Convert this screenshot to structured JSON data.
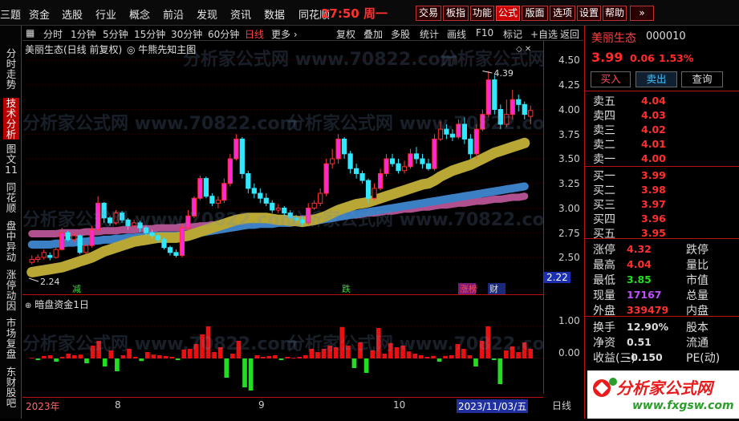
{
  "menu": {
    "items": [
      "三题",
      "资金",
      "选股",
      "行业",
      "概念",
      "前沿",
      "发现",
      "资讯",
      "数据",
      "同花顺"
    ],
    "clock": "27:50",
    "weekday": "周一",
    "buttons": [
      "交易",
      "板指",
      "功能",
      "公式",
      "版面",
      "选项",
      "设置",
      "帮助",
      "»"
    ]
  },
  "sidebar": [
    "分时走势",
    "技术分析",
    "图文11",
    "同花顺",
    "盘中异动",
    "涨停动因",
    "市场复盘",
    "东财股吧"
  ],
  "toolbar": {
    "periods": [
      "分时",
      "1分钟",
      "5分钟",
      "15分钟",
      "30分钟",
      "60分钟",
      "日线",
      "更多 ›"
    ],
    "tools": [
      "复权",
      "叠加",
      "多股",
      "统计",
      "画线",
      "F10",
      "标记",
      "+自选",
      "返回"
    ]
  },
  "chart": {
    "title": "美丽生态(日线 前复权)",
    "indicator": "◎ 牛熊先知主图",
    "hi_label": "4.39",
    "lo_label": "2.24",
    "marks": [
      "减",
      "跌",
      "涨榜",
      "财"
    ],
    "sub_title": "暗盘资金1日",
    "cursor_price": "2.22",
    "cursor_date": "2023/11/03/五",
    "period_tag": "日线"
  },
  "y_main": [
    "4.50",
    "4.25",
    "4.00",
    "3.75",
    "3.50",
    "3.25",
    "3.00",
    "2.75",
    "2.50"
  ],
  "y_sub": [
    "1.00",
    "0.00"
  ],
  "x_dates": [
    "2023年",
    "8",
    "9",
    "10"
  ],
  "quote": {
    "name": "美丽生态",
    "code": "000010",
    "price": "3.99",
    "change": "0.06",
    "pct": "1.53%",
    "actions": [
      "买入",
      "卖出",
      "查询"
    ],
    "asks": [
      {
        "l": "卖五",
        "p": "4.04"
      },
      {
        "l": "卖四",
        "p": "4.03"
      },
      {
        "l": "卖三",
        "p": "4.02"
      },
      {
        "l": "卖二",
        "p": "4.01"
      },
      {
        "l": "卖一",
        "p": "4.00"
      }
    ],
    "bids": [
      {
        "l": "买一",
        "p": "3.99"
      },
      {
        "l": "买二",
        "p": "3.98"
      },
      {
        "l": "买三",
        "p": "3.97"
      },
      {
        "l": "买四",
        "p": "3.96"
      },
      {
        "l": "买五",
        "p": "3.95"
      }
    ],
    "stats": [
      {
        "l": "涨停",
        "v": "4.32",
        "r": "跌停"
      },
      {
        "l": "最高",
        "v": "4.04",
        "r": "量比"
      },
      {
        "l": "最低",
        "v": "3.85",
        "r": "市值"
      },
      {
        "l": "现量",
        "v": "17167",
        "r": "总量"
      },
      {
        "l": "外盘",
        "v": "339479",
        "r": "内盘"
      }
    ],
    "stats2": [
      {
        "l": "换手",
        "v": "12.90%",
        "r": "股本"
      },
      {
        "l": "净资",
        "v": "0.51",
        "r": "流通"
      },
      {
        "l": "收益(三)",
        "v": "-0.150",
        "r": "PE(动)"
      }
    ]
  },
  "watermark": {
    "site": "分析家公式网",
    "url": "www.fxgsw.com",
    "tile": "分析家公式网 www.70822.com"
  },
  "colors": {
    "up": "#ff1a1a",
    "down": "#22e0ff",
    "vol_up": "#e81010",
    "vol_down": "#22dd22",
    "band_yellow": "#c9b53a",
    "band_blue": "#3b7fc4",
    "band_pink": "#c45a9a"
  },
  "chart_data": {
    "type": "candlestick",
    "ylim": [
      2.4,
      4.55
    ],
    "candles": [
      [
        2.45,
        2.48,
        2.52,
        2.43
      ],
      [
        2.48,
        2.5,
        2.53,
        2.45
      ],
      [
        2.5,
        2.55,
        2.58,
        2.48
      ],
      [
        2.52,
        2.5,
        2.55,
        2.47
      ],
      [
        2.5,
        2.58,
        2.6,
        2.49
      ],
      [
        2.58,
        2.75,
        2.8,
        2.57
      ],
      [
        2.75,
        2.68,
        2.77,
        2.66
      ],
      [
        2.68,
        2.72,
        2.75,
        2.65
      ],
      [
        2.72,
        2.55,
        2.73,
        2.53
      ],
      [
        2.55,
        2.62,
        2.65,
        2.53
      ],
      [
        2.62,
        2.78,
        2.82,
        2.6
      ],
      [
        2.78,
        3.05,
        3.12,
        2.76
      ],
      [
        3.05,
        2.9,
        3.06,
        2.85
      ],
      [
        2.9,
        2.85,
        2.92,
        2.82
      ],
      [
        2.85,
        2.95,
        2.98,
        2.83
      ],
      [
        2.95,
        2.88,
        2.97,
        2.85
      ],
      [
        2.88,
        2.82,
        2.9,
        2.78
      ],
      [
        2.82,
        2.85,
        2.88,
        2.8
      ],
      [
        2.85,
        2.8,
        2.87,
        2.76
      ],
      [
        2.8,
        2.75,
        2.82,
        2.72
      ],
      [
        2.75,
        2.72,
        2.78,
        2.69
      ],
      [
        2.72,
        2.68,
        2.74,
        2.65
      ],
      [
        2.68,
        2.6,
        2.7,
        2.58
      ],
      [
        2.6,
        2.55,
        2.62,
        2.52
      ],
      [
        2.55,
        2.52,
        2.58,
        2.5
      ],
      [
        2.52,
        2.8,
        2.84,
        2.5
      ],
      [
        2.8,
        2.92,
        2.98,
        2.78
      ],
      [
        2.92,
        3.1,
        3.12,
        2.9
      ],
      [
        3.1,
        3.3,
        3.33,
        3.08
      ],
      [
        3.3,
        3.12,
        3.32,
        3.1
      ],
      [
        3.12,
        3.05,
        3.15,
        3.02
      ],
      [
        3.05,
        3.08,
        3.12,
        3.0
      ],
      [
        3.08,
        3.25,
        3.3,
        3.05
      ],
      [
        3.25,
        3.5,
        3.55,
        3.22
      ],
      [
        3.5,
        3.7,
        3.75,
        3.48
      ],
      [
        3.7,
        3.35,
        3.72,
        3.3
      ],
      [
        3.35,
        3.2,
        3.38,
        3.15
      ],
      [
        3.2,
        3.15,
        3.25,
        3.1
      ],
      [
        3.15,
        3.1,
        3.2,
        3.05
      ],
      [
        3.1,
        3.05,
        3.15,
        3.02
      ],
      [
        3.05,
        2.98,
        3.08,
        2.95
      ],
      [
        2.98,
        3.0,
        3.04,
        2.95
      ],
      [
        3.0,
        2.95,
        3.02,
        2.92
      ],
      [
        2.95,
        2.9,
        2.98,
        2.87
      ],
      [
        2.9,
        2.88,
        2.93,
        2.85
      ],
      [
        2.88,
        2.85,
        2.92,
        2.82
      ],
      [
        2.85,
        3.0,
        3.05,
        2.83
      ],
      [
        3.0,
        3.05,
        3.08,
        2.98
      ],
      [
        3.05,
        3.15,
        3.2,
        3.02
      ],
      [
        3.15,
        3.45,
        3.5,
        3.12
      ],
      [
        3.45,
        3.5,
        3.6,
        3.4
      ],
      [
        3.5,
        3.7,
        3.75,
        3.45
      ],
      [
        3.7,
        3.55,
        3.72,
        3.5
      ],
      [
        3.55,
        3.4,
        3.58,
        3.35
      ],
      [
        3.4,
        3.35,
        3.45,
        3.3
      ],
      [
        3.35,
        3.28,
        3.38,
        3.25
      ],
      [
        3.28,
        3.1,
        3.3,
        3.05
      ],
      [
        3.1,
        3.2,
        3.25,
        3.08
      ],
      [
        3.2,
        3.35,
        3.4,
        3.18
      ],
      [
        3.35,
        3.5,
        3.55,
        3.32
      ],
      [
        3.5,
        3.45,
        3.55,
        3.42
      ],
      [
        3.45,
        3.38,
        3.5,
        3.35
      ],
      [
        3.38,
        3.42,
        3.48,
        3.35
      ],
      [
        3.42,
        3.55,
        3.6,
        3.4
      ],
      [
        3.55,
        3.5,
        3.62,
        3.45
      ],
      [
        3.5,
        3.45,
        3.55,
        3.4
      ],
      [
        3.45,
        3.4,
        3.5,
        3.38
      ],
      [
        3.4,
        3.7,
        3.75,
        3.38
      ],
      [
        3.7,
        3.8,
        3.88,
        3.68
      ],
      [
        3.8,
        3.75,
        3.85,
        3.7
      ],
      [
        3.75,
        3.72,
        3.8,
        3.68
      ],
      [
        3.72,
        3.85,
        3.9,
        3.7
      ],
      [
        3.85,
        3.7,
        3.92,
        3.65
      ],
      [
        3.7,
        3.55,
        3.75,
        3.5
      ],
      [
        3.55,
        3.8,
        3.85,
        3.5
      ],
      [
        3.8,
        3.95,
        4.0,
        3.78
      ],
      [
        3.95,
        4.3,
        4.39,
        3.92
      ],
      [
        4.3,
        4.0,
        4.35,
        3.95
      ],
      [
        4.0,
        3.85,
        4.05,
        3.8
      ],
      [
        3.85,
        3.95,
        4.1,
        3.82
      ],
      [
        3.95,
        4.1,
        4.2,
        3.9
      ],
      [
        4.1,
        4.05,
        4.15,
        3.98
      ],
      [
        4.05,
        3.95,
        4.08,
        3.9
      ],
      [
        3.93,
        3.99,
        4.04,
        3.85
      ]
    ],
    "band_yellow": [
      2.35,
      2.36,
      2.37,
      2.38,
      2.39,
      2.4,
      2.42,
      2.44,
      2.46,
      2.48,
      2.5,
      2.53,
      2.56,
      2.58,
      2.6,
      2.62,
      2.64,
      2.66,
      2.67,
      2.68,
      2.69,
      2.7,
      2.7,
      2.7,
      2.7,
      2.71,
      2.72,
      2.74,
      2.76,
      2.78,
      2.8,
      2.82,
      2.84,
      2.86,
      2.88,
      2.89,
      2.9,
      2.9,
      2.9,
      2.9,
      2.89,
      2.88,
      2.88,
      2.87,
      2.87,
      2.86,
      2.87,
      2.88,
      2.9,
      2.92,
      2.95,
      2.98,
      3.0,
      3.02,
      3.04,
      3.05,
      3.06,
      3.08,
      3.1,
      3.12,
      3.14,
      3.16,
      3.18,
      3.2,
      3.22,
      3.24,
      3.25,
      3.28,
      3.32,
      3.35,
      3.38,
      3.4,
      3.42,
      3.44,
      3.47,
      3.5,
      3.53,
      3.56,
      3.58,
      3.6,
      3.62,
      3.64,
      3.66
    ],
    "band_blue": [
      2.63,
      2.63,
      2.63,
      2.63,
      2.64,
      2.64,
      2.65,
      2.65,
      2.66,
      2.66,
      2.67,
      2.67,
      2.68,
      2.68,
      2.69,
      2.69,
      2.7,
      2.7,
      2.71,
      2.71,
      2.72,
      2.72,
      2.72,
      2.72,
      2.72,
      2.73,
      2.73,
      2.74,
      2.75,
      2.76,
      2.77,
      2.78,
      2.79,
      2.8,
      2.81,
      2.82,
      2.83,
      2.83,
      2.84,
      2.84,
      2.84,
      2.85,
      2.85,
      2.85,
      2.86,
      2.86,
      2.87,
      2.87,
      2.88,
      2.89,
      2.9,
      2.91,
      2.92,
      2.93,
      2.94,
      2.95,
      2.96,
      2.97,
      2.98,
      2.99,
      3.0,
      3.01,
      3.02,
      3.03,
      3.04,
      3.05,
      3.06,
      3.07,
      3.08,
      3.09,
      3.1,
      3.11,
      3.12,
      3.13,
      3.14,
      3.15,
      3.16,
      3.17,
      3.18,
      3.19,
      3.2,
      3.21,
      3.22
    ],
    "band_pink": [
      2.74,
      2.74,
      2.74,
      2.74,
      2.74,
      2.75,
      2.75,
      2.75,
      2.75,
      2.76,
      2.76,
      2.76,
      2.77,
      2.77,
      2.77,
      2.78,
      2.78,
      2.78,
      2.79,
      2.79,
      2.79,
      2.8,
      2.8,
      2.8,
      2.8,
      2.81,
      2.81,
      2.81,
      2.82,
      2.82,
      2.83,
      2.83,
      2.84,
      2.84,
      2.85,
      2.85,
      2.86,
      2.86,
      2.86,
      2.87,
      2.87,
      2.87,
      2.88,
      2.88,
      2.88,
      2.89,
      2.89,
      2.9,
      2.9,
      2.91,
      2.91,
      2.92,
      2.92,
      2.93,
      2.93,
      2.94,
      2.95,
      2.95,
      2.96,
      2.97,
      2.97,
      2.98,
      2.99,
      2.99,
      3.0,
      3.01,
      3.01,
      3.02,
      3.03,
      3.03,
      3.04,
      3.05,
      3.05,
      3.06,
      3.07,
      3.07,
      3.08,
      3.09,
      3.09,
      3.1,
      3.11,
      3.11,
      3.12
    ],
    "sub_values": [
      0.02,
      -0.05,
      0.08,
      0.1,
      -0.1,
      0.05,
      0.15,
      0.1,
      0.12,
      -0.15,
      0.4,
      0.55,
      -0.25,
      0.25,
      -0.4,
      0.1,
      0.3,
      0.05,
      -0.08,
      0.2,
      0.12,
      0.1,
      0.08,
      0.05,
      -0.05,
      0.28,
      0.3,
      0.45,
      0.75,
      1.0,
      0.2,
      0.35,
      -0.6,
      0.15,
      0.55,
      -0.9,
      -1.0,
      0.1,
      0.05,
      0.08,
      0.1,
      -0.05,
      0.05,
      0.02,
      0.05,
      0.1,
      0.3,
      0.2,
      0.3,
      0.4,
      0.35,
      0.98,
      0.4,
      -0.3,
      0.5,
      -0.45,
      0.25,
      0.95,
      0.15,
      0.48,
      0.35,
      0.4,
      0.22,
      0.15,
      0.1,
      0.05,
      0.08,
      -0.1,
      0.08,
      0.1,
      0.45,
      0.3,
      0.1,
      -0.25,
      0.55,
      1.0,
      -0.05,
      -0.8,
      0.25,
      0.38,
      0.2,
      0.5,
      0.3
    ]
  }
}
